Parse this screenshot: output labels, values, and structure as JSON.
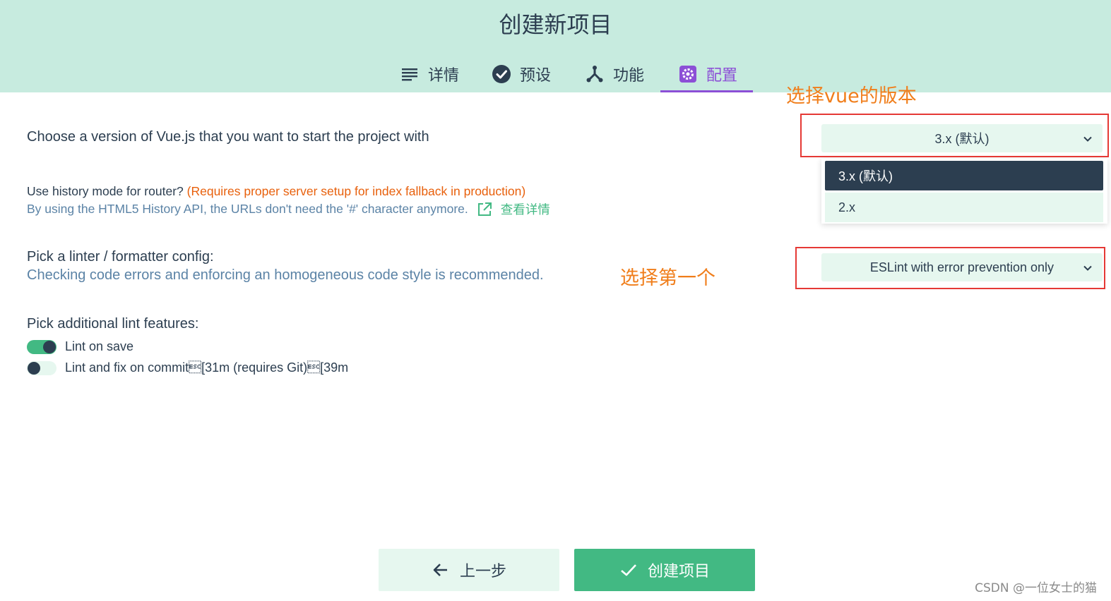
{
  "header": {
    "title": "创建新项目",
    "tabs": [
      {
        "label": "详情",
        "icon": "list-icon"
      },
      {
        "label": "预设",
        "icon": "check-circle-icon"
      },
      {
        "label": "功能",
        "icon": "fork-icon"
      },
      {
        "label": "配置",
        "icon": "settings-icon",
        "active": true
      }
    ]
  },
  "vue_version": {
    "label": "Choose a version of Vue.js that you want to start the project with",
    "selected": "3.x (默认)",
    "options": [
      "3.x (默认)",
      "2.x"
    ]
  },
  "history_mode": {
    "label": "Use history mode for router?",
    "warning": "(Requires proper server setup for index fallback in production)",
    "description": "By using the HTML5 History API, the URLs don't need the '#' character anymore.",
    "link": "查看详情"
  },
  "linter": {
    "label": "Pick a linter / formatter config:",
    "description": "Checking code errors and enforcing an homogeneous code style is recommended.",
    "selected": "ESLint with error prevention only"
  },
  "lint_features": {
    "label": "Pick additional lint features:",
    "options": [
      {
        "label": "Lint on save",
        "enabled": true
      },
      {
        "label": "Lint and fix on commit\u001b[31m (requires Git)\u001b[39m",
        "enabled": false
      }
    ]
  },
  "annotations": {
    "vue_version_note": "选择vue的版本",
    "linter_note": "选择第一个"
  },
  "footer": {
    "prev_label": "上一步",
    "create_label": "创建项目"
  },
  "watermark": "CSDN @一位女士的猫",
  "colors": {
    "header_bg": "#c7ebdf",
    "accent": "#42b983",
    "active_tab": "#8c4fd6",
    "warning": "#e8600c",
    "annotation": "#f07e1b",
    "highlight_box": "#e53935"
  }
}
